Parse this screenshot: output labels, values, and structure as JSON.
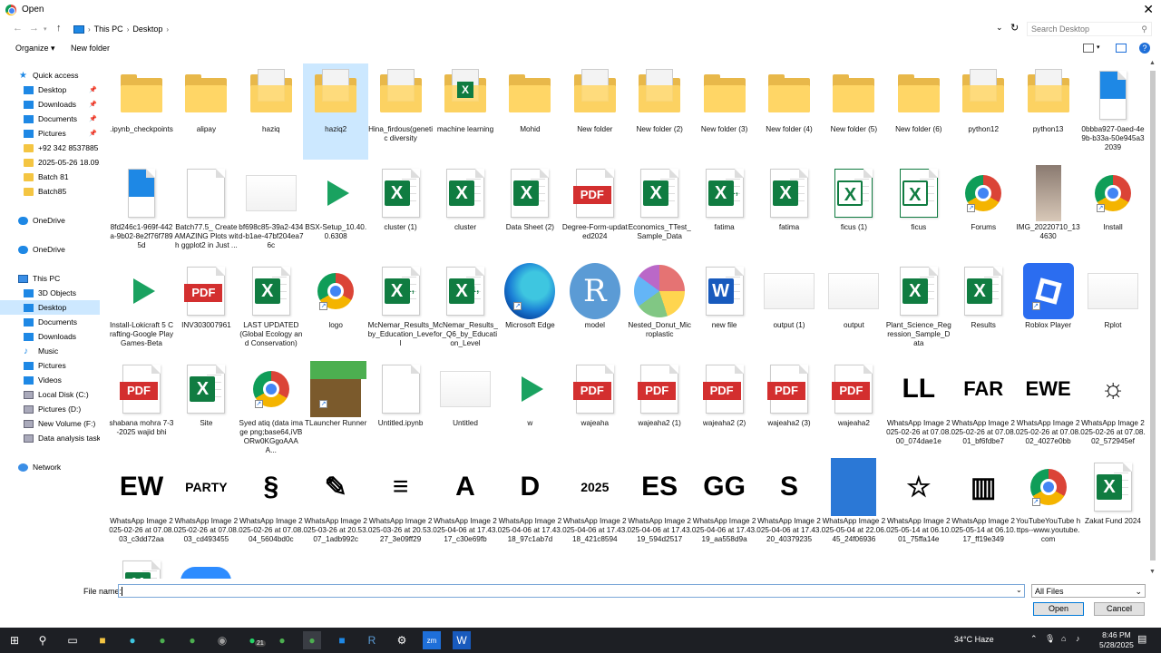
{
  "window": {
    "title": "Open",
    "close": "✕"
  },
  "address": {
    "segments": [
      "This PC",
      "Desktop"
    ],
    "search_placeholder": "Search Desktop"
  },
  "toolbar": {
    "organize": "Organize ▾",
    "new_folder": "New folder",
    "help": "?"
  },
  "nav": [
    {
      "label": "Quick access",
      "icon": "star",
      "indent": 0,
      "pinned": false
    },
    {
      "label": "Desktop",
      "icon": "blue",
      "indent": 1,
      "pinned": true
    },
    {
      "label": "Downloads",
      "icon": "blue",
      "indent": 1,
      "pinned": true
    },
    {
      "label": "Documents",
      "icon": "blue",
      "indent": 1,
      "pinned": true
    },
    {
      "label": "Pictures",
      "icon": "blue",
      "indent": 1,
      "pinned": true
    },
    {
      "label": "+92 342 8537885",
      "icon": "folder",
      "indent": 1,
      "pinned": false
    },
    {
      "label": "2025-05-26 18.09.45",
      "icon": "folder",
      "indent": 1,
      "pinned": false
    },
    {
      "label": "Batch 81",
      "icon": "folder",
      "indent": 1,
      "pinned": false
    },
    {
      "label": "Batch85",
      "icon": "folder",
      "indent": 1,
      "pinned": false
    },
    {
      "label": "",
      "icon": "",
      "indent": 0,
      "pinned": false
    },
    {
      "label": "OneDrive",
      "icon": "cloud",
      "indent": 0,
      "pinned": false
    },
    {
      "label": "",
      "icon": "",
      "indent": 0,
      "pinned": false
    },
    {
      "label": "OneDrive",
      "icon": "cloud",
      "indent": 0,
      "pinned": false
    },
    {
      "label": "",
      "icon": "",
      "indent": 0,
      "pinned": false
    },
    {
      "label": "This PC",
      "icon": "pc",
      "indent": 0,
      "pinned": false
    },
    {
      "label": "3D Objects",
      "icon": "blue",
      "indent": 1,
      "pinned": false
    },
    {
      "label": "Desktop",
      "icon": "blue",
      "indent": 1,
      "pinned": false,
      "selected": true
    },
    {
      "label": "Documents",
      "icon": "blue",
      "indent": 1,
      "pinned": false
    },
    {
      "label": "Downloads",
      "icon": "blue",
      "indent": 1,
      "pinned": false
    },
    {
      "label": "Music",
      "icon": "music",
      "indent": 1,
      "pinned": false
    },
    {
      "label": "Pictures",
      "icon": "blue",
      "indent": 1,
      "pinned": false
    },
    {
      "label": "Videos",
      "icon": "blue",
      "indent": 1,
      "pinned": false
    },
    {
      "label": "Local Disk (C:)",
      "icon": "disk",
      "indent": 1,
      "pinned": false
    },
    {
      "label": "Pictures (D:)",
      "icon": "disk",
      "indent": 1,
      "pinned": false
    },
    {
      "label": "New Volume (F:)",
      "icon": "disk",
      "indent": 1,
      "pinned": false
    },
    {
      "label": "Data analysis task  (",
      "icon": "disk",
      "indent": 1,
      "pinned": false
    },
    {
      "label": "",
      "icon": "",
      "indent": 0,
      "pinned": false
    },
    {
      "label": "Network",
      "icon": "net",
      "indent": 0,
      "pinned": false
    }
  ],
  "files": [
    [
      {
        "name": ".ipynb_checkpoints",
        "type": "folder"
      },
      {
        "name": "alipay",
        "type": "folder"
      },
      {
        "name": "haziq",
        "type": "folder-doc"
      },
      {
        "name": "haziq2",
        "type": "folder-doc",
        "selected": true
      },
      {
        "name": "Hina_firdous(genetic diversity",
        "type": "folder-doc"
      },
      {
        "name": "machine learning",
        "type": "folder-excel"
      },
      {
        "name": "Mohid",
        "type": "folder"
      },
      {
        "name": "New folder",
        "type": "folder-doc"
      },
      {
        "name": "New folder (2)",
        "type": "folder-doc"
      },
      {
        "name": "New folder (3)",
        "type": "folder"
      },
      {
        "name": "New folder (4)",
        "type": "folder"
      },
      {
        "name": "New folder (5)",
        "type": "folder"
      },
      {
        "name": "New folder (6)",
        "type": "folder"
      },
      {
        "name": "python12",
        "type": "folder-doc"
      },
      {
        "name": "python13",
        "type": "folder-doc"
      },
      {
        "name": "0bbba927-0aed-4e9b-b33a-50e945a32039",
        "type": "blue-doc"
      }
    ],
    [
      {
        "name": "8fd246c1-969f-442a-9b02-8e2f76f7895d",
        "type": "blue-doc"
      },
      {
        "name": "Batch77.5_ Create AMAZING Plots with ggplot2 in Just ...",
        "type": "doc"
      },
      {
        "name": "bf698c85-39a2-434d-b1ae-47bf204ea76c",
        "type": "light"
      },
      {
        "name": "BSX-Setup_10.40.0.6308",
        "type": "gplay"
      },
      {
        "name": "cluster (1)",
        "type": "excel"
      },
      {
        "name": "cluster",
        "type": "excel"
      },
      {
        "name": "Data Sheet (2)",
        "type": "excel"
      },
      {
        "name": "Degree-Form-updated2024",
        "type": "pdf"
      },
      {
        "name": "Economics_TTest_Sample_Data",
        "type": "excel"
      },
      {
        "name": "fatima",
        "type": "excel-a"
      },
      {
        "name": "fatima",
        "type": "excel"
      },
      {
        "name": "ficus (1)",
        "type": "excel-o"
      },
      {
        "name": "ficus",
        "type": "excel-o"
      },
      {
        "name": "Forums",
        "type": "chrome"
      },
      {
        "name": "IMG_20220710_134630",
        "type": "photo"
      },
      {
        "name": "Install",
        "type": "chrome"
      }
    ],
    [
      {
        "name": "Install-Lokicraft 5 Crafting-Google PlayGames-Beta",
        "type": "gplay"
      },
      {
        "name": "INV303007961",
        "type": "pdf"
      },
      {
        "name": "LAST UPDATED (Global Ecology and Conservation)",
        "type": "excel"
      },
      {
        "name": "logo",
        "type": "chrome"
      },
      {
        "name": "McNemar_Results_by_Education_Level",
        "type": "excel-a"
      },
      {
        "name": "McNemar_Results_for_Q6_by_Education_Level",
        "type": "excel-a"
      },
      {
        "name": "Microsoft Edge",
        "type": "edge"
      },
      {
        "name": "model",
        "type": "rlogo"
      },
      {
        "name": "Nested_Donut_Microplastic",
        "type": "pie"
      },
      {
        "name": "new file",
        "type": "word"
      },
      {
        "name": "output (1)",
        "type": "light"
      },
      {
        "name": "output",
        "type": "light"
      },
      {
        "name": "Plant_Science_Regression_Sample_Data",
        "type": "excel"
      },
      {
        "name": "Results",
        "type": "excel"
      },
      {
        "name": "Roblox Player",
        "type": "roblox"
      },
      {
        "name": "Rplot",
        "type": "light"
      }
    ],
    [
      {
        "name": "shabana mohra 7-3-2025 wajid bhi",
        "type": "pdf"
      },
      {
        "name": "Site",
        "type": "excel"
      },
      {
        "name": "Syed atiq (data image png;base64,iVBORw0KGgoAAAA...",
        "type": "chrome"
      },
      {
        "name": "TLauncher Runner",
        "type": "minecraft"
      },
      {
        "name": "Untitled.ipynb",
        "type": "doc"
      },
      {
        "name": "Untitled",
        "type": "light"
      },
      {
        "name": "w",
        "type": "gplay"
      },
      {
        "name": "wajeaha",
        "type": "pdf"
      },
      {
        "name": "wajeaha2 (1)",
        "type": "pdf"
      },
      {
        "name": "wajeaha2 (2)",
        "type": "pdf"
      },
      {
        "name": "wajeaha2 (3)",
        "type": "pdf"
      },
      {
        "name": "wajeaha2",
        "type": "pdf"
      },
      {
        "name": "WhatsApp Image 2025-02-26 at 07.08.00_074dae1e",
        "type": "wa",
        "art": "LL"
      },
      {
        "name": "WhatsApp Image 2025-02-26 at 07.08.01_bf6fdbe7",
        "type": "wa",
        "art": "FAR"
      },
      {
        "name": "WhatsApp Image 2025-02-26 at 07.08.02_4027e0bb",
        "type": "wa",
        "art": "EWE"
      },
      {
        "name": "WhatsApp Image 2025-02-26 at 07.08.02_572945ef",
        "type": "wa",
        "art": "☼"
      }
    ],
    [
      {
        "name": "WhatsApp Image 2025-02-26 at 07.08.03_c3dd72aa",
        "type": "wa",
        "art": "EW"
      },
      {
        "name": "WhatsApp Image 2025-02-26 at 07.08.03_cd493455",
        "type": "wa",
        "art": "PARTY"
      },
      {
        "name": "WhatsApp Image 2025-02-26 at 07.08.04_5604bd0c",
        "type": "wa",
        "art": "§"
      },
      {
        "name": "WhatsApp Image 2025-03-26 at 20.53.07_1adb992c",
        "type": "wa",
        "art": "✎"
      },
      {
        "name": "WhatsApp Image 2025-03-26 at 20.53.27_3e09ff29",
        "type": "wa",
        "art": "≡"
      },
      {
        "name": "WhatsApp Image 2025-04-06 at 17.43.17_c30e69fb",
        "type": "wa",
        "art": "A"
      },
      {
        "name": "WhatsApp Image 2025-04-06 at 17.43.18_97c1ab7d",
        "type": "wa",
        "art": "D"
      },
      {
        "name": "WhatsApp Image 2025-04-06 at 17.43.18_421c8594",
        "type": "wa",
        "art": "2025"
      },
      {
        "name": "WhatsApp Image 2025-04-06 at 17.43.19_594d2517",
        "type": "wa",
        "art": "ES"
      },
      {
        "name": "WhatsApp Image 2025-04-06 at 17.43.19_aa558d9a",
        "type": "wa",
        "art": "GG"
      },
      {
        "name": "WhatsApp Image 2025-04-06 at 17.43.20_40379235",
        "type": "wa",
        "art": "S"
      },
      {
        "name": "WhatsApp Image 2025-05-04 at 22.06.45_24f06936",
        "type": "wa-blue",
        "art": ""
      },
      {
        "name": "WhatsApp Image 2025-05-14 at 06.10.01_75ffa14e",
        "type": "wa",
        "art": "☆"
      },
      {
        "name": "WhatsApp Image 2025-05-14 at 06.10.17_ff19e349",
        "type": "wa",
        "art": "▥"
      },
      {
        "name": "YouTubeYouTube https--www.youtube.com",
        "type": "chrome"
      },
      {
        "name": "Zakat Fund 2024",
        "type": "excel"
      }
    ],
    [
      {
        "name": "",
        "type": "excel"
      },
      {
        "name": "",
        "type": "zoom"
      }
    ]
  ],
  "footer": {
    "filename_label": "File name:",
    "filetype": "All Files",
    "open": "Open",
    "cancel": "Cancel"
  },
  "taskbar": {
    "weather": "34°C  Haze",
    "time": "8:46 PM",
    "date": "5/28/2025",
    "badge": "21"
  }
}
